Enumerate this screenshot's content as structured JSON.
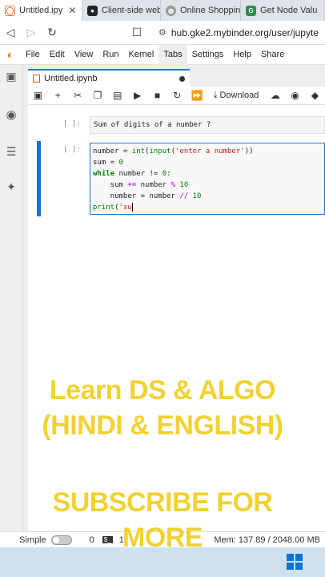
{
  "browser": {
    "tabs": [
      {
        "title": "Untitled.ipy",
        "active": true
      },
      {
        "title": "Client-side web"
      },
      {
        "title": "Online Shoppin"
      },
      {
        "title": "Get Node Valu"
      }
    ],
    "url": "hub.gke2.mybinder.org/user/jupyte"
  },
  "menu": {
    "items": [
      "File",
      "Edit",
      "View",
      "Run",
      "Kernel",
      "Tabs",
      "Settings",
      "Help",
      "Share"
    ]
  },
  "notebook": {
    "tab_title": "Untitled.ipynb",
    "download_label": "Download",
    "cells": [
      {
        "prompt": "[ ]:",
        "text": "Sum of digits of a number ?"
      },
      {
        "prompt": "[ ]:"
      }
    ],
    "code_tokens": {
      "l1a": "number = ",
      "l1b": "int",
      "l1c": "(",
      "l1d": "input",
      "l1e": "(",
      "l1f": "'enter a number'",
      "l1g": "))",
      "l2a": "sum = ",
      "l2b": "0",
      "l3a": "while",
      "l3b": " number != ",
      "l3c": "0",
      "l3d": ":",
      "l4a": "    sum ",
      "l4b": "+=",
      "l4c": " number ",
      "l4d": "%",
      "l4e": " ",
      "l4f": "10",
      "l5a": "    number = number ",
      "l5b": "//",
      "l5c": " ",
      "l5d": "10",
      "l6a": "print",
      "l6b": "(",
      "l6c": "'su"
    }
  },
  "overlay": {
    "line1": "Learn DS & ALGO",
    "line2": "(HINDI & ENGLISH)",
    "line3": "SUBSCRIBE FOR",
    "line4": "MORE"
  },
  "status": {
    "mode": "Simple",
    "count_a": "0",
    "count_b": "1",
    "mem": "Mem: 137.89 / 2048.00 MB"
  },
  "colors": {
    "accent": "#1976d2",
    "overlay_text": "#f2d232",
    "jupyter_orange": "#f37726"
  }
}
